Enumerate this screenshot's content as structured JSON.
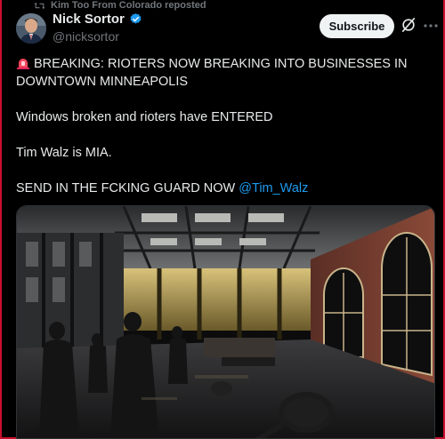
{
  "repost": {
    "text": "Kim Too From Colorado reposted",
    "icon": "repost-icon"
  },
  "author": {
    "name": "Nick Sortor",
    "handle": "@nicksortor",
    "verified": true
  },
  "actions": {
    "subscribe_label": "Subscribe",
    "grok_icon": "grok-icon",
    "more_icon": "more-icon"
  },
  "post": {
    "line1": "BREAKING: RIOTERS NOW BREAKING INTO BUSINESSES IN DOWNTOWN MINNEAPOLIS",
    "line2": "Windows broken and rioters have ENTERED",
    "line3": "Tim Walz is MIA.",
    "line4_text": "SEND IN THE FCKING GUARD NOW ",
    "line4_mention": "@Tim_Walz"
  },
  "colors": {
    "accent": "#1d9bf0",
    "border": "#c8102e",
    "muted": "#71767b"
  }
}
